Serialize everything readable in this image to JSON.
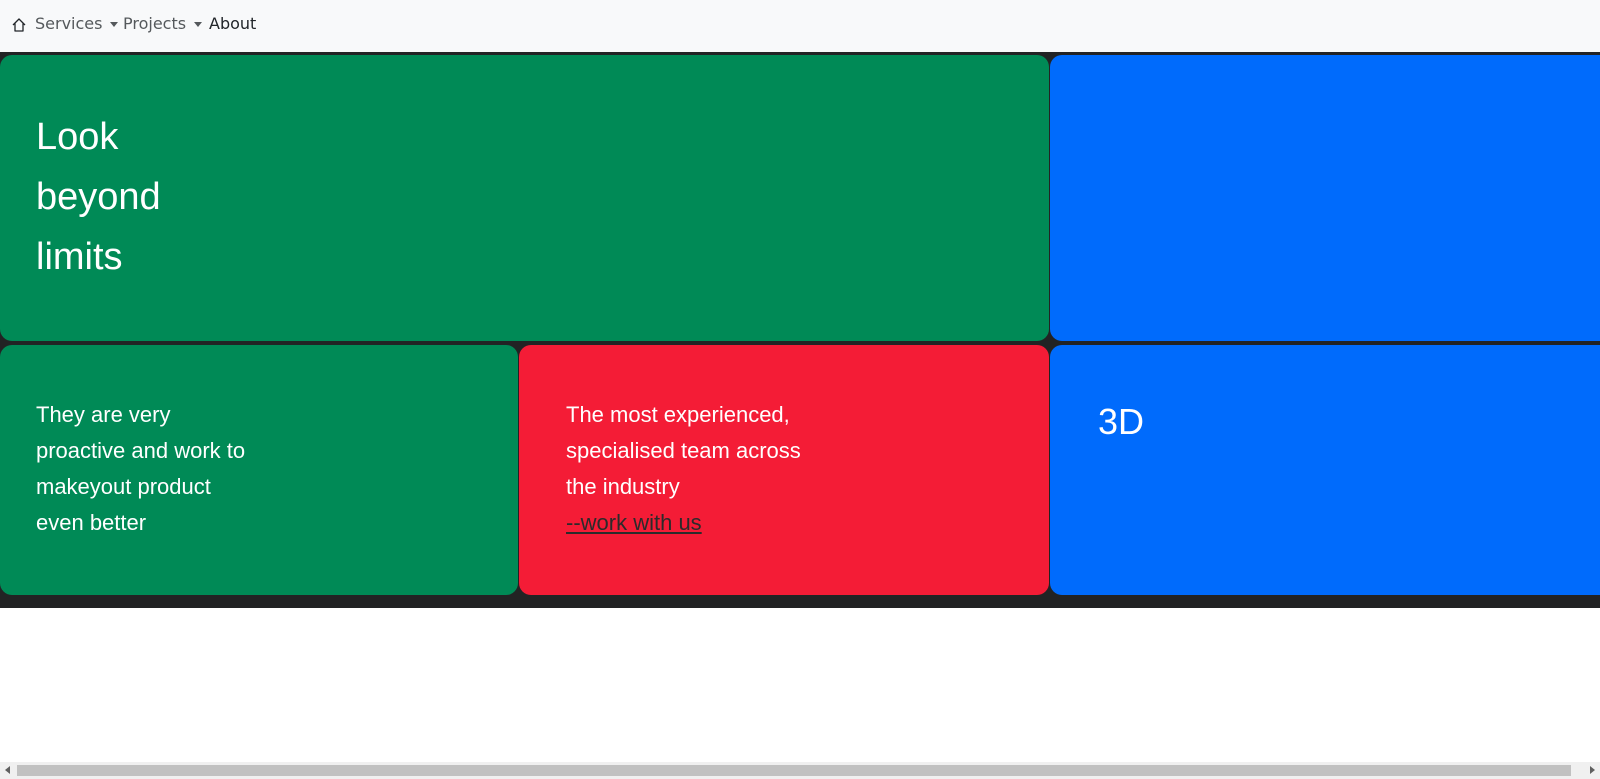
{
  "nav": {
    "home_icon": "home-icon",
    "services_label": "Services",
    "projects_label": "Projects",
    "about_label": "About"
  },
  "tiles": {
    "hero_line1": "Look",
    "hero_line2": "beyond",
    "hero_line3": "limits",
    "green_text_line1": "They are very",
    "green_text_line2": "proactive and work to",
    "green_text_line3": "makeyout product",
    "green_text_line4": "even better",
    "red_text_line1": "The most experienced,",
    "red_text_line2": "specialised team across",
    "red_text_line3": "the industry",
    "red_link": "--work with us",
    "blue_label": "3D"
  },
  "colors": {
    "green": "#008a56",
    "blue": "#006bfc",
    "red": "#f41c36",
    "navbar": "#f8f9fa",
    "grid_background": "#222324"
  }
}
